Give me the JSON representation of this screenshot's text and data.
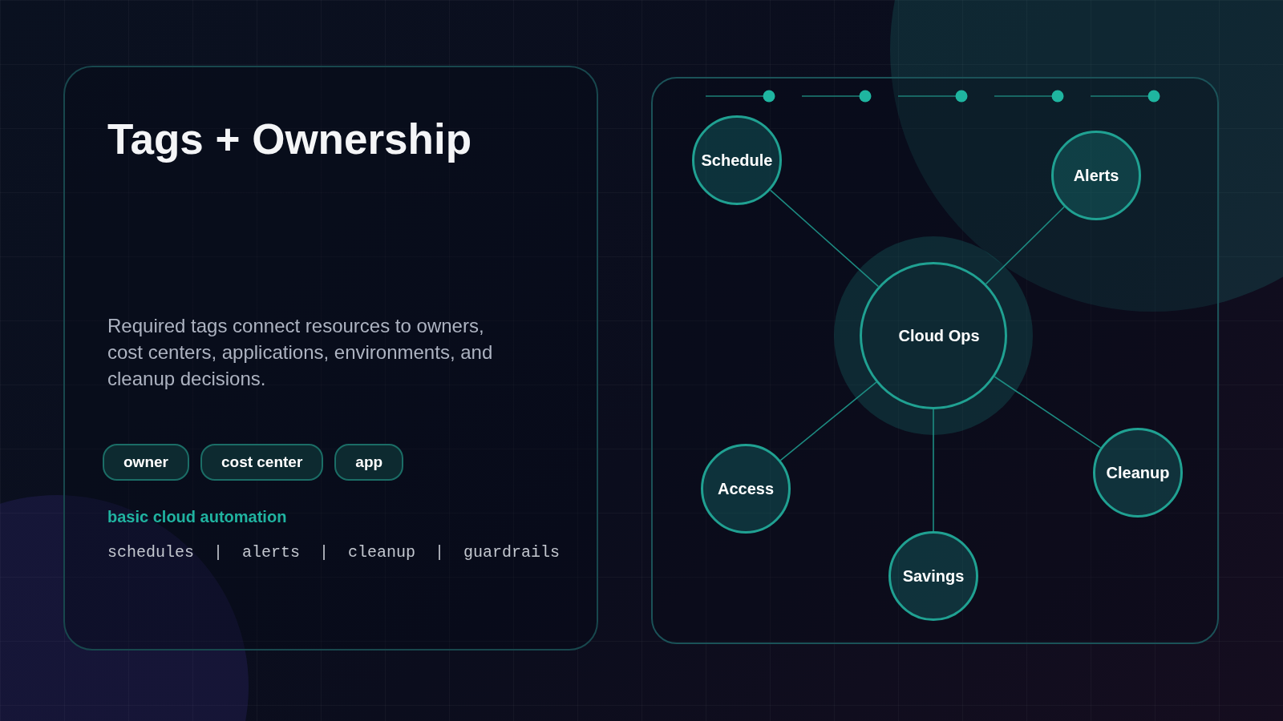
{
  "title": "Tags + Ownership",
  "description": "Required tags connect resources to owners, cost centers, applications, environments, and cleanup decisions.",
  "tags": [
    "owner",
    "cost center",
    "app"
  ],
  "automation": {
    "heading": "basic cloud automation",
    "items": "schedules  |  alerts  |  cleanup  |  guardrails"
  },
  "diagram": {
    "hub": "Cloud Ops",
    "nodes": [
      {
        "label": "Schedule"
      },
      {
        "label": "Alerts"
      },
      {
        "label": "Access"
      },
      {
        "label": "Cleanup"
      },
      {
        "label": "Savings"
      }
    ]
  }
}
